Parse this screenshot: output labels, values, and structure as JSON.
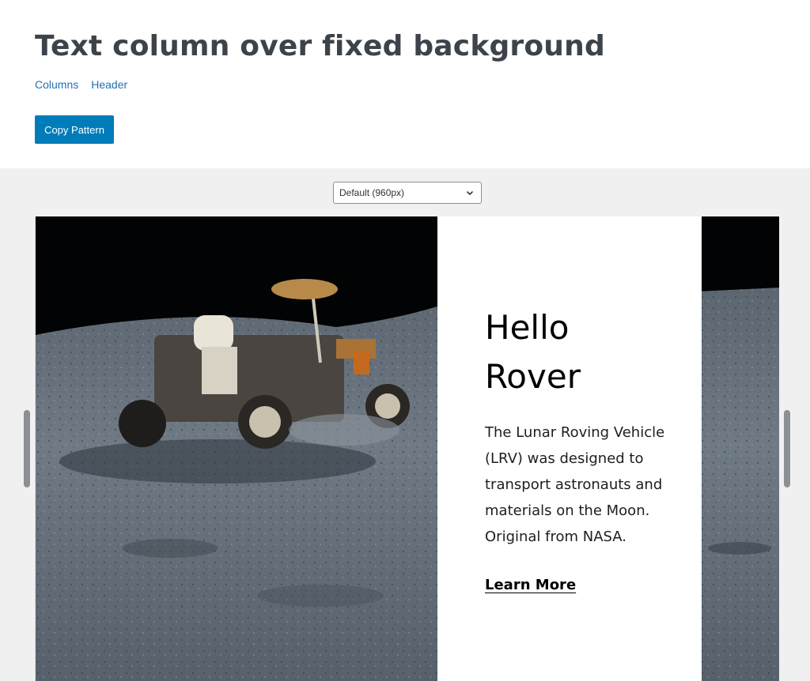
{
  "page": {
    "title": "Text column over fixed background",
    "categories": [
      "Columns",
      "Header"
    ],
    "copy_button": "Copy Pattern"
  },
  "preview": {
    "width_select": {
      "selected": "Default (960px)"
    }
  },
  "pattern": {
    "heading_line1": "Hello",
    "heading_line2": "Rover",
    "body": "The Lunar Roving Vehicle (LRV) was designed to transport astronauts and materials on the Moon. Original from NASA.",
    "link": "Learn More"
  },
  "colors": {
    "accent": "#007cba",
    "link": "#2271b1",
    "preview_bg": "#f0f0f1",
    "handle": "#8c8f94"
  },
  "icons": {
    "select_chevron": "chevron-down-icon"
  }
}
